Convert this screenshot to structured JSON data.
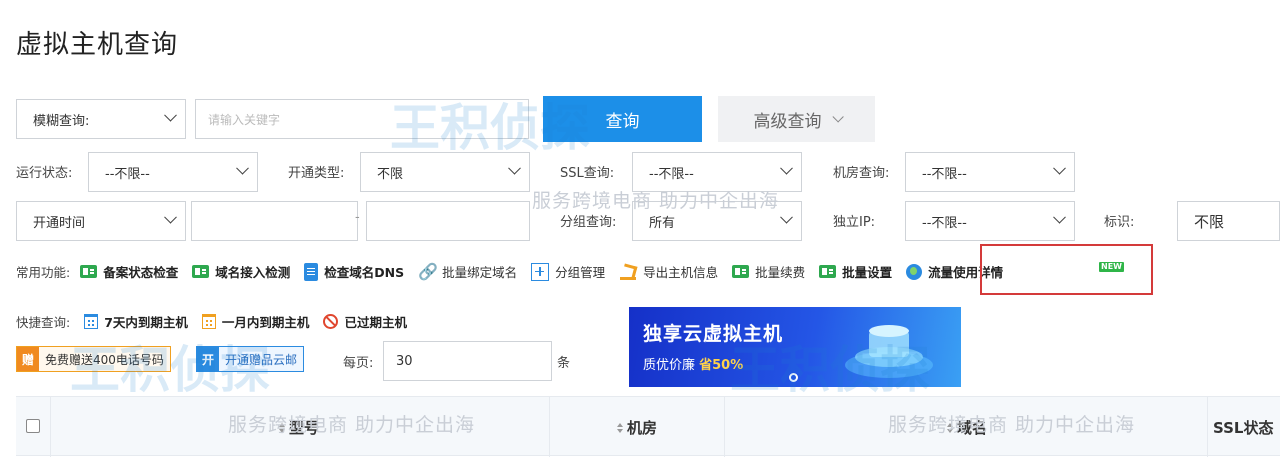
{
  "page_title": "虚拟主机查询",
  "search": {
    "mode_select": "模糊查询:",
    "keyword_placeholder": "请输入关键字",
    "query_button": "查询",
    "advanced_button": "高级查询"
  },
  "filters": {
    "run_status_label": "运行状态:",
    "run_status_value": "--不限--",
    "open_type_label": "开通类型:",
    "open_type_value": "不限",
    "ssl_label": "SSL查询:",
    "ssl_value": "--不限--",
    "room_label": "机房查询:",
    "room_value": "--不限--",
    "open_time_select": "开通时间",
    "range_sep": "-",
    "group_label": "分组查询:",
    "group_value": "所有",
    "ip_label": "独立IP:",
    "ip_value": "--不限--",
    "flag_label": "标识:",
    "flag_value": "不限"
  },
  "functions": {
    "label": "常用功能:",
    "items": [
      {
        "label": "备案状态检查",
        "icon": "record-check-icon"
      },
      {
        "label": "域名接入检测",
        "icon": "domain-check-icon"
      },
      {
        "label": "检查域名DNS",
        "icon": "dns-check-icon"
      },
      {
        "label": "批量绑定域名",
        "icon": "link-icon"
      },
      {
        "label": "分组管理",
        "icon": "group-icon"
      },
      {
        "label": "导出主机信息",
        "icon": "export-icon"
      },
      {
        "label": "批量续费",
        "icon": "renew-icon"
      },
      {
        "label": "批量设置",
        "icon": "settings-icon"
      },
      {
        "label": "流量使用详情",
        "icon": "globe-icon"
      }
    ],
    "new_badge": "NEW"
  },
  "quick": {
    "label": "快捷查询:",
    "items": [
      {
        "label": "7天内到期主机",
        "icon": "calendar-icon"
      },
      {
        "label": "一月内到期主机",
        "icon": "calendar-icon"
      },
      {
        "label": "已过期主机",
        "icon": "ban-icon"
      }
    ]
  },
  "promos": {
    "gift_tag": "赠",
    "gift_text": "免费赠送400电话号码",
    "open_tag": "开",
    "open_text": "开通赠品云邮",
    "per_page_label": "每页:",
    "per_page_value": "30",
    "per_page_unit": "条"
  },
  "banner": {
    "title": "独享云虚拟主机",
    "subtitle_prefix": "质优价廉 ",
    "subtitle_highlight": "省50%"
  },
  "table": {
    "columns": [
      "型号",
      "机房",
      "域名",
      "SSL状态"
    ]
  },
  "watermark": {
    "brand": "王积侦探",
    "slogan": "服务跨境电商 助力中企出海"
  },
  "colors": {
    "primary": "#1c8fe8",
    "highlight_border": "#d43a3a",
    "new_badge": "#2fb548"
  }
}
